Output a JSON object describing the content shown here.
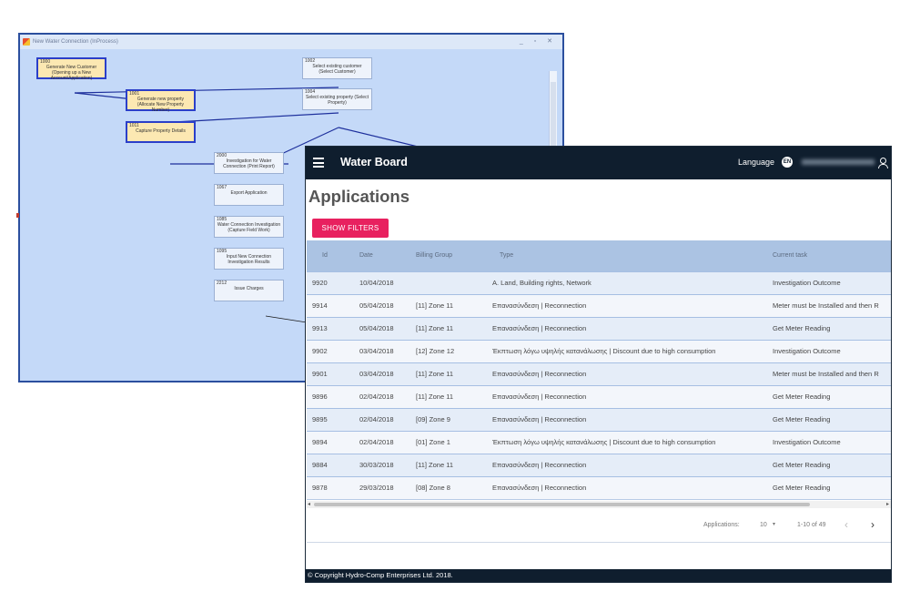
{
  "workflow": {
    "window_title": "New Water Connection (InProcess)",
    "window_controls": "_ ▫ ✕",
    "boxes": [
      {
        "id": "1000",
        "text": "Generate New Customer (Opening up a New Account/Application)",
        "highlight": true
      },
      {
        "id": "1002",
        "text": "Select existing customer (Select Customer)",
        "highlight": false
      },
      {
        "id": "1001",
        "text": "Generate new property (Allocate New Property Number)",
        "highlight": true
      },
      {
        "id": "1004",
        "text": "Select existing property (Select Property)",
        "highlight": false
      },
      {
        "id": "1011",
        "text": "Capture Property Details",
        "highlight": true
      },
      {
        "id": "2000",
        "text": "Investigation for Water Connection (Print Report)",
        "highlight": false
      },
      {
        "id": "1067",
        "text": "Export Application",
        "highlight": false
      },
      {
        "id": "1085",
        "text": "Water Connection Investigation (Capture Field Work)",
        "highlight": false
      },
      {
        "id": "1095",
        "text": "Input New Connection Investigation Results",
        "highlight": false
      },
      {
        "id": "2212",
        "text": "Issue Charges",
        "highlight": false
      }
    ]
  },
  "app": {
    "brand": "Water Board",
    "language_label": "Language",
    "globe_icon_text": "EN",
    "page_title": "Applications",
    "show_filters_label": "Show Filters",
    "columns": [
      "Id",
      "Date",
      "Billing Group",
      "Type",
      "Current task"
    ],
    "rows": [
      [
        "9920",
        "10/04/2018",
        "",
        "A. Land, Building rights, Network",
        "Investigation Outcome"
      ],
      [
        "9914",
        "05/04/2018",
        "[11] Zone 11",
        "Επανασύνδεση | Reconnection",
        "Meter must be Installed and then R"
      ],
      [
        "9913",
        "05/04/2018",
        "[11] Zone 11",
        "Επανασύνδεση | Reconnection",
        "Get Meter Reading"
      ],
      [
        "9902",
        "03/04/2018",
        "[12] Zone 12",
        "Έκπτωση λόγω υψηλής κατανάλωσης | Discount due to high consumption",
        "Investigation Outcome"
      ],
      [
        "9901",
        "03/04/2018",
        "[11] Zone 11",
        "Επανασύνδεση | Reconnection",
        "Meter must be Installed and then R"
      ],
      [
        "9896",
        "02/04/2018",
        "[11] Zone 11",
        "Επανασύνδεση | Reconnection",
        "Get Meter Reading"
      ],
      [
        "9895",
        "02/04/2018",
        "[09] Zone 9",
        "Επανασύνδεση | Reconnection",
        "Get Meter Reading"
      ],
      [
        "9894",
        "02/04/2018",
        "[01] Zone 1",
        "Έκπτωση λόγω υψηλής κατανάλωσης | Discount due to high consumption",
        "Investigation Outcome"
      ],
      [
        "9884",
        "30/03/2018",
        "[11] Zone 11",
        "Επανασύνδεση | Reconnection",
        "Get Meter Reading"
      ],
      [
        "9878",
        "29/03/2018",
        "[08] Zone 8",
        "Επανασύνδεση | Reconnection",
        "Get Meter Reading"
      ]
    ],
    "pagination": {
      "label": "Applications:",
      "page_size": "10",
      "range": "1-10 of 49"
    },
    "footer": "© Copyright Hydro-Comp Enterprises Ltd. 2018."
  }
}
